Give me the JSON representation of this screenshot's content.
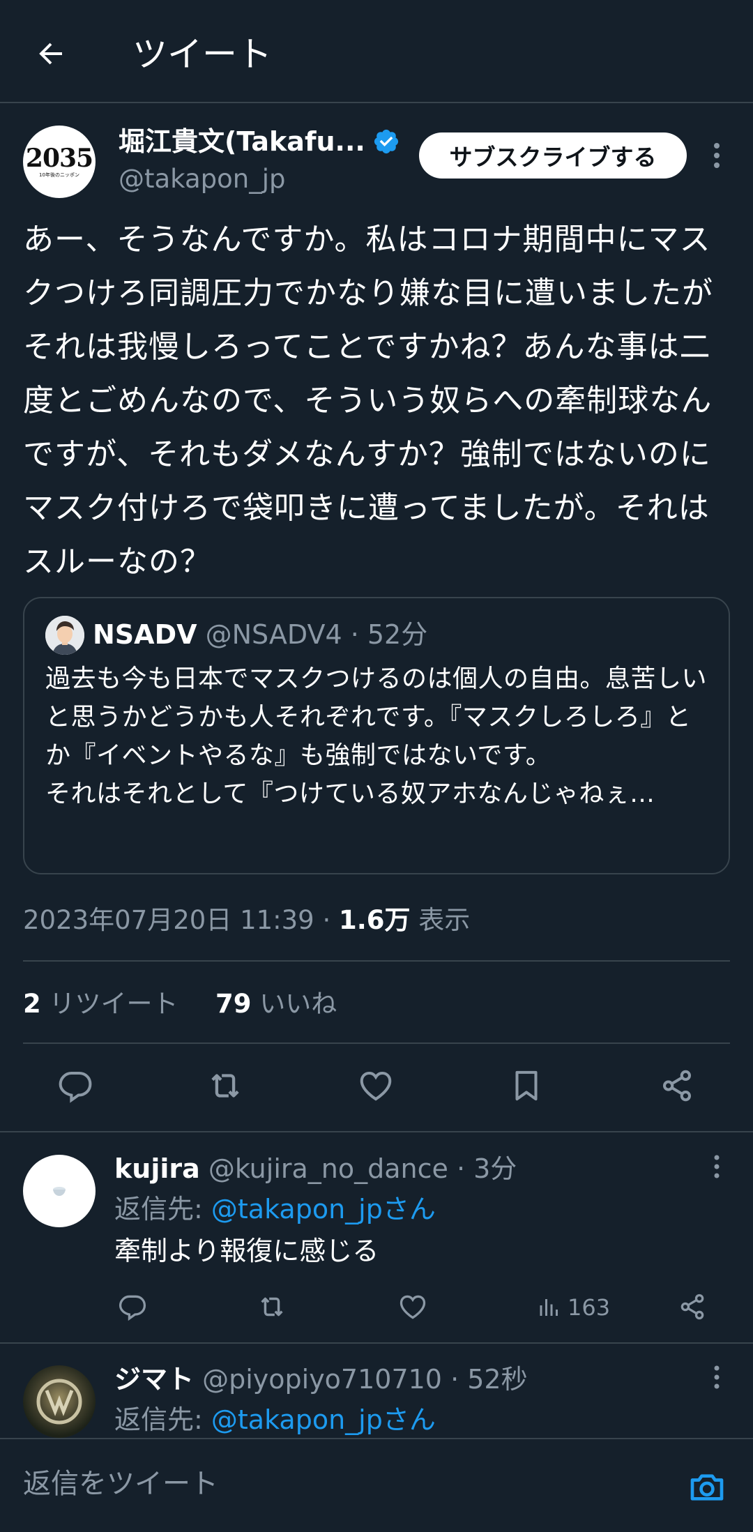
{
  "header": {
    "title": "ツイート"
  },
  "author": {
    "name": "堀江貴文(Takafu...",
    "handle": "@takapon_jp",
    "avatar_text": "2035",
    "avatar_subtext": "10年後のニッポン",
    "subscribe_label": "サブスクライブする"
  },
  "tweet": {
    "text": "あー、そうなんですか。私はコロナ期間中にマスクつけろ同調圧力でかなり嫌な目に遭いましたがそれは我慢しろってことですかね？あんな事は二度とごめんなので、そういう奴らへの牽制球なんですが、それもダメなんすか？強制ではないのにマスク付けろで袋叩きに遭ってましたが。それはスルーなの？"
  },
  "quote": {
    "name": "NSADV",
    "handle_time": " @NSADV4 · 52分",
    "text": "過去も今も日本でマスクつけるのは個人の自由。息苦しいと思うかどうかも人それぞれです。『マスクしろしろ』とか『イベントやるな』も強制ではないです。\nそれはそれとして『つけている奴アホなんじゃねぇ..."
  },
  "meta": {
    "datetime": "2023年07月20日 11:39 · ",
    "views_count": "1.6万",
    "views_label": " 表示",
    "retweet_count": "2",
    "retweet_label": " リツイート",
    "like_count": "79",
    "like_label": " いいね"
  },
  "replies": [
    {
      "name": "kujira",
      "handle_time": " @kujira_no_dance · 3分",
      "reply_to_prefix": "返信先: ",
      "reply_to_link": "@takapon_jpさん",
      "text": "牽制より報復に感じる",
      "views": "163"
    },
    {
      "name": "ジマト",
      "handle_time": " @piyopiyo710710 · 52秒",
      "reply_to_prefix": "返信先: ",
      "reply_to_link": "@takapon_jpさん"
    }
  ],
  "compose": {
    "placeholder": "返信をツイート"
  },
  "icons": {
    "back": "arrow-left-icon",
    "verified": "verified-badge-icon",
    "more": "more-vertical-icon",
    "reply": "reply-icon",
    "retweet": "retweet-icon",
    "like": "heart-icon",
    "bookmark": "bookmark-icon",
    "share": "share-icon",
    "views": "bar-chart-icon",
    "camera": "camera-icon"
  },
  "colors": {
    "background": "#15202b",
    "accent": "#1d9bf0",
    "muted": "#8b98a5",
    "border": "#38444d"
  }
}
